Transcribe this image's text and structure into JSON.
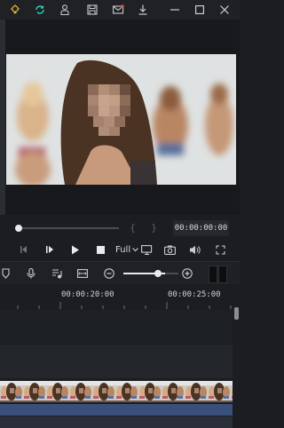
{
  "toolbar_icons": [
    "bulb-icon",
    "sync-icon",
    "account-icon",
    "save-icon",
    "mail-icon",
    "download-icon",
    "minimize-icon",
    "maximize-icon",
    "close-icon"
  ],
  "colors": {
    "accent": "#2fd1b8",
    "badge": "#e74c3c",
    "clip": "#5a4b43",
    "audio": "#3a4f7a"
  },
  "player": {
    "timecode": "00:00:00:00",
    "quality": "Full",
    "brace_open": "{",
    "brace_close": "}",
    "progress": 0.0
  },
  "timeline": {
    "zoom": 0.75,
    "ruler_labels": [
      "00:00:20:00",
      "00:00:25:00"
    ]
  }
}
